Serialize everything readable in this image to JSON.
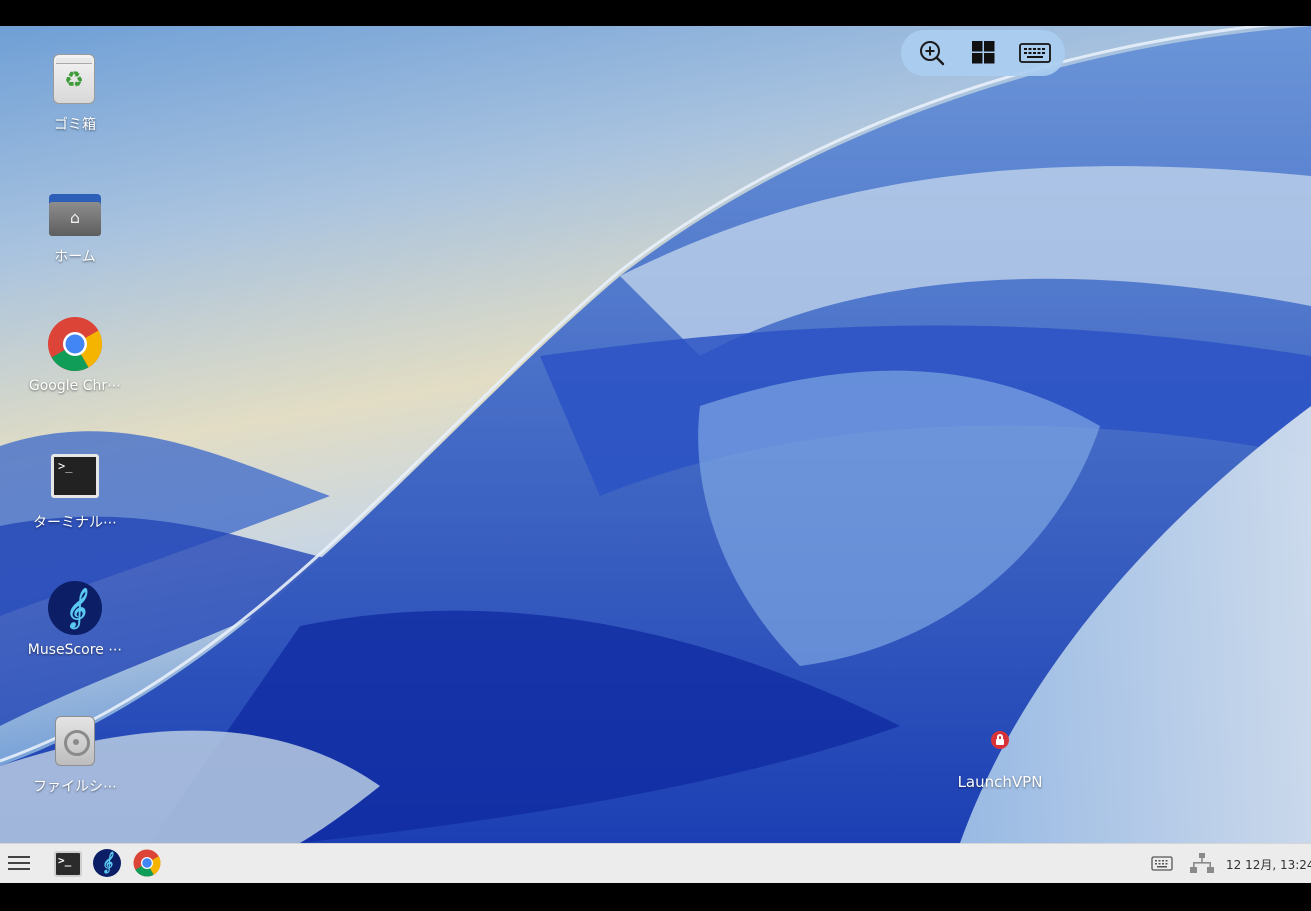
{
  "desktop": {
    "icons": [
      {
        "label": "ゴミ箱",
        "icon": "trash-icon"
      },
      {
        "label": "ホーム",
        "icon": "home-folder-icon"
      },
      {
        "label": "Google Chr⋯",
        "icon": "chrome-icon"
      },
      {
        "label": "ターミナル⋯",
        "icon": "terminal-icon"
      },
      {
        "label": "MuseScore ⋯",
        "icon": "musescore-icon"
      },
      {
        "label": "ファイルシ⋯",
        "icon": "filesystem-disk-icon"
      }
    ],
    "vpn": {
      "label": "LaunchVPN",
      "icon": "lock-icon"
    }
  },
  "toolbar": {
    "buttons": [
      "zoom-in-icon",
      "windows-grid-icon",
      "keyboard-icon"
    ]
  },
  "taskbar": {
    "menu_icon": "hamburger-menu-icon",
    "apps": [
      "terminal-icon",
      "musescore-icon",
      "chrome-icon"
    ],
    "tray": [
      "keyboard-icon",
      "network-icon"
    ],
    "clock": "12 12月, 13:24"
  },
  "colors": {
    "taskbar_bg": "#ececec",
    "toolbar_bg": "#aacdf0",
    "vpn_lock": "#d9333a",
    "musescore_bg": "#0c1f66"
  }
}
